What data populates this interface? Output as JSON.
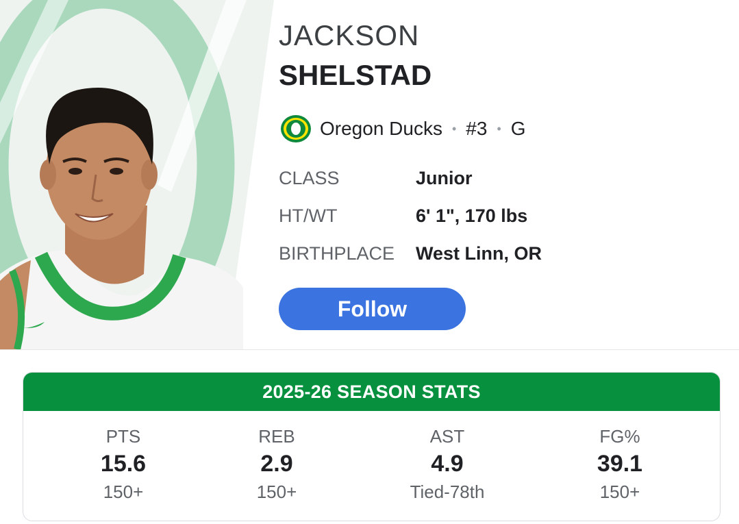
{
  "player": {
    "first_name": "JACKSON",
    "last_name": "SHELSTAD",
    "team": "Oregon Ducks",
    "number": "#3",
    "position": "G",
    "separator": "•"
  },
  "details": [
    {
      "label": "CLASS",
      "value": "Junior"
    },
    {
      "label": "HT/WT",
      "value": "6' 1\", 170 lbs"
    },
    {
      "label": "BIRTHPLACE",
      "value": "West Linn, OR"
    }
  ],
  "actions": {
    "follow_label": "Follow"
  },
  "season_stats": {
    "title": "2025-26 SEASON STATS",
    "items": [
      {
        "label": "PTS",
        "value": "15.6",
        "rank": "150+"
      },
      {
        "label": "REB",
        "value": "2.9",
        "rank": "150+"
      },
      {
        "label": "AST",
        "value": "4.9",
        "rank": "Tied-78th"
      },
      {
        "label": "FG%",
        "value": "39.1",
        "rank": "150+"
      }
    ]
  },
  "colors": {
    "accent_green": "#07913f",
    "follow_blue": "#3b73e0",
    "oregon_green": "#154733"
  },
  "icons": {
    "team_logo": "oregon-o-logo-icon",
    "player_photo": "player-headshot"
  }
}
